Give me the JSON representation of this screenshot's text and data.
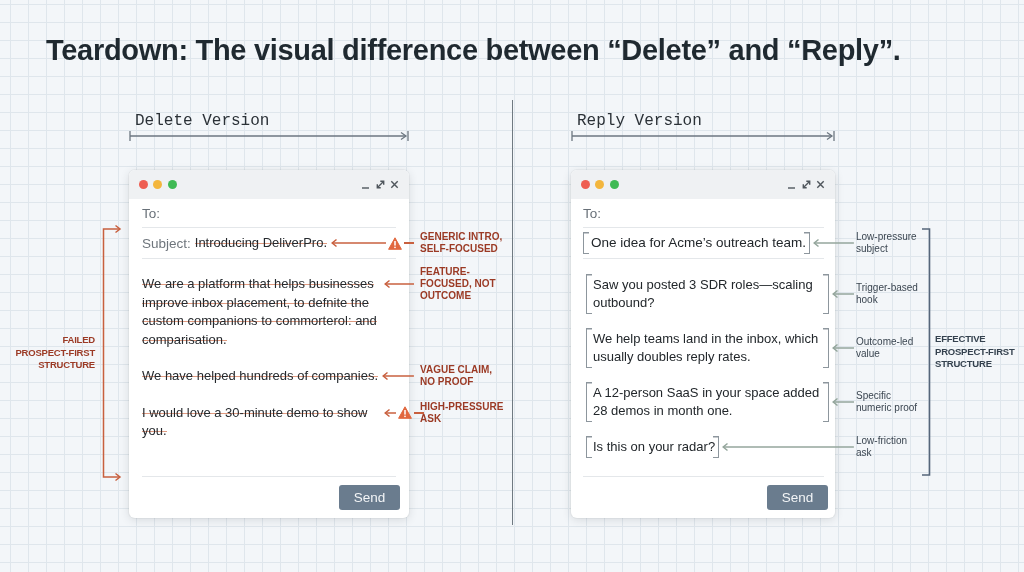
{
  "title": "Teardown: The visual difference between “Delete” and “Reply”.",
  "versions": [
    {
      "kind": "delete",
      "heading": "Delete Version",
      "to_label": "To:",
      "subject_label": "Subject:",
      "subject": {
        "text": "Introducing DeliverPro.",
        "note": {
          "label": "GENERIC INTRO, SELF-FOCUSED",
          "warning": true
        }
      },
      "paragraphs": [
        {
          "text": "We are a platform that helps businesses improve inbox placement, to defnite the custom companions to commorterol: and comparisation.",
          "note": {
            "label": "FEATURE-FOCUSED, NOT OUTCOME",
            "warning": false
          }
        },
        {
          "text": "We have helped hundreds of companies.",
          "note": {
            "label": "VAGUE CLAIM, NO PROOF",
            "warning": false
          }
        },
        {
          "text": "I would love a 30-minute demo to show you.",
          "note": {
            "label": "HIGH-PRESSURE ASK",
            "warning": true
          }
        }
      ],
      "send": "Send",
      "structure_label": "FAILED PROSPECT-FIRST STRUCTURE"
    },
    {
      "kind": "reply",
      "heading": "Reply Version",
      "to_label": "To:",
      "subject": {
        "text": "One idea for Acme’s outreach team.",
        "note": {
          "label": "Low-pressure subject",
          "warning": false
        }
      },
      "paragraphs": [
        {
          "text": "Saw you posted 3 SDR roles—scaling outbound?",
          "note": {
            "label": "Trigger-based hook",
            "warning": false
          }
        },
        {
          "text": "We help teams land in the inbox, which usually doubles reply rates.",
          "note": {
            "label": "Outcome-led value",
            "warning": false
          }
        },
        {
          "text": "A 12-person SaaS in your space added 28 demos in month one.",
          "note": {
            "label": "Specific numeric proof",
            "warning": false
          }
        },
        {
          "text": "Is this on your radar?",
          "note": {
            "label": "Low-friction ask",
            "warning": false
          }
        }
      ],
      "send": "Send",
      "structure_label": "EFFECTIVE PROSPECT-FIRST STRUCTURE"
    }
  ]
}
